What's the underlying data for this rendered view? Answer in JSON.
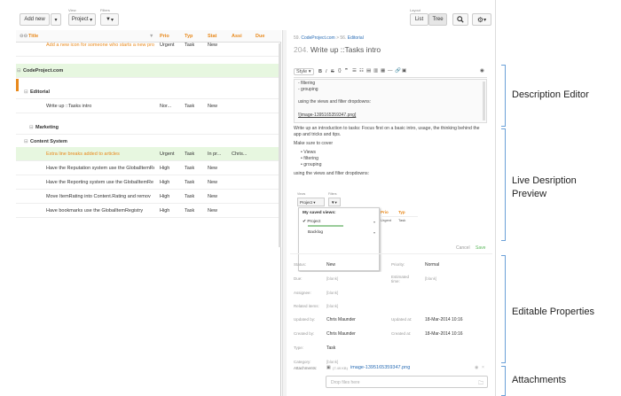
{
  "toolbar": {
    "add_new": "Add new",
    "view_label": "View",
    "view_value": "Project",
    "filters_label": "Filters",
    "layout_label": "Layout",
    "list": "List",
    "tree": "Tree"
  },
  "grid": {
    "columns": [
      "Title",
      "Prio",
      "Typ",
      "Stat",
      "Assi",
      "Due"
    ],
    "rows": [
      {
        "title": "Add a new icon for someone who starts a new proj...",
        "prio": "Urgent",
        "type": "Task",
        "status": "New",
        "assignee": "",
        "style": "normal"
      },
      {
        "title": "CodeProject.com",
        "prio": "",
        "type": "",
        "status": "",
        "assignee": "",
        "style": "group1"
      },
      {
        "title": "Editorial",
        "prio": "",
        "type": "",
        "status": "",
        "assignee": "",
        "style": "group2"
      },
      {
        "title": "Write up ::Tasks intro",
        "prio": "Nor...",
        "type": "Task",
        "status": "New",
        "assignee": "",
        "style": "selected"
      },
      {
        "title": "Marketing",
        "prio": "",
        "type": "",
        "status": "",
        "assignee": "",
        "style": "group2b"
      },
      {
        "title": "Content System",
        "prio": "",
        "type": "",
        "status": "",
        "assignee": "",
        "style": "group2"
      },
      {
        "title": "Extra line breaks added to articles",
        "prio": "Urgent",
        "type": "Task",
        "status": "In pr...",
        "assignee": "Chris...",
        "style": "orange"
      },
      {
        "title": "Have the Reputation system use the GlobalItemRe",
        "prio": "High",
        "type": "Task",
        "status": "New",
        "assignee": "",
        "style": "normal"
      },
      {
        "title": "Have the Reporting system use the GlobalItemRe",
        "prio": "High",
        "type": "Task",
        "status": "New",
        "assignee": "",
        "style": "normal"
      },
      {
        "title": "Move ItemRating into Content.Rating and remov",
        "prio": "High",
        "type": "Task",
        "status": "New",
        "assignee": "",
        "style": "normal"
      },
      {
        "title": "Have bookmarks use the GlobalItemRegistry",
        "prio": "High",
        "type": "Task",
        "status": "New",
        "assignee": "",
        "style": "normal"
      }
    ]
  },
  "detail": {
    "breadcrumb1": "CodeProject.com",
    "breadcrumb2": "Editorial",
    "item_number": "204.",
    "item_title": "Write up ::Tasks intro",
    "editor_style": "Style",
    "editor_lines": [
      "- filtering",
      "- grouping",
      "",
      "using the views and filter dropdowns:",
      "",
      "![image-1395165359347.png]"
    ],
    "preview_intro": "Write up an introduction to tasks: Focus first on a basic intro, usage, the thinking behind the app and tricks and tips.",
    "preview_make_sure": "Make sure to cover",
    "preview_bullets": [
      "Views",
      "filtering",
      "grouping"
    ],
    "preview_using": "using the views and filter dropdowns:",
    "mini_view": "Views",
    "mini_filters": "Filters",
    "mini_project": "Project",
    "mini_saved": "My saved views:",
    "mini_project_item": "Project",
    "mini_backlog": "Backlog",
    "mini_prio": "Prio",
    "mini_type": "Typ",
    "mini_urgent": "Urgent",
    "mini_task": "Task",
    "cancel": "Cancel",
    "save": "Save",
    "props": {
      "status_label": "Status:",
      "status_value": "New",
      "priority_label": "Priority:",
      "priority_value": "Normal",
      "due_label": "Due:",
      "due_value": "[blank]",
      "est_label": "Estimated time:",
      "est_value": "[blank]",
      "assignee_label": "Assignee:",
      "assignee_value": "[blank]",
      "related_label": "Related items:",
      "related_value": "[blank]",
      "updated_by_label": "Updated by:",
      "updated_by_value": "Chris Maunder",
      "updated_at_label": "Updated at:",
      "updated_at_value": "18-Mar-2014 10:16",
      "created_by_label": "Created by:",
      "created_by_value": "Chris Maunder",
      "created_at_label": "Created at:",
      "created_at_value": "18-Mar-2014 10:16",
      "type_label": "Type:",
      "type_value": "Task",
      "category_label": "Category:",
      "category_value": "[blank]"
    },
    "attachments_label": "Attachments:",
    "attachment_size": "(7.49 KB)",
    "attachment_name": "image-1395165359347.png",
    "drop_files": "Drop files here"
  },
  "annotations": {
    "description_editor": "Description Editor",
    "live_preview_1": "Live Desription",
    "live_preview_2": "Preview",
    "editable_properties": "Editable Properties",
    "attachments": "Attachments"
  },
  "colors": {
    "accent_orange": "#e8891c",
    "green_row": "#e7f7e0",
    "link_blue": "#2a6db5",
    "save_green": "#5cb85c"
  }
}
